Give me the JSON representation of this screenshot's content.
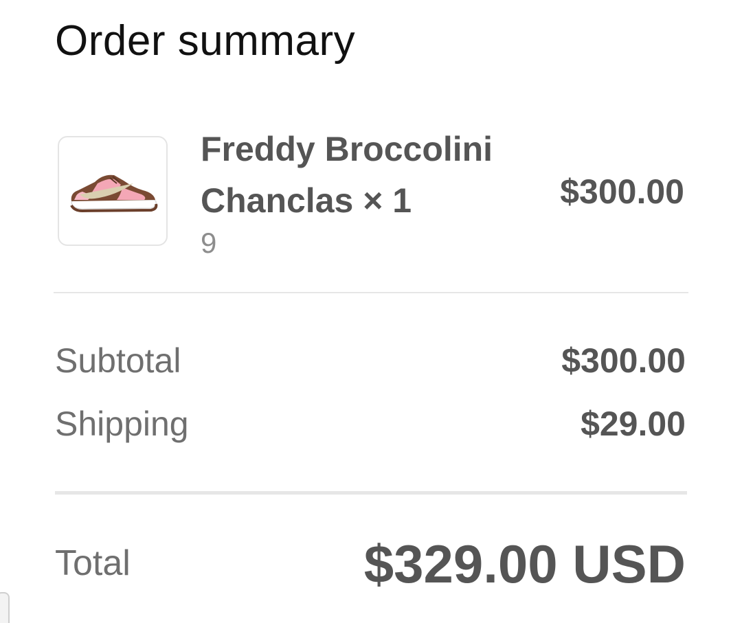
{
  "order_summary": {
    "title": "Order summary",
    "item": {
      "name": "Freddy Broccolini Chanclas × 1",
      "variant": "9",
      "price": "$300.00",
      "image_icon": "sneaker-image"
    },
    "subtotal": {
      "label": "Subtotal",
      "value": "$300.00"
    },
    "shipping": {
      "label": "Shipping",
      "value": "$29.00"
    },
    "total": {
      "label": "Total",
      "value": "$329.00 USD"
    }
  },
  "colors": {
    "primary_text": "#111111",
    "muted_text": "#6f6f6f",
    "value_text": "#555555",
    "divider": "#e6e6e6"
  }
}
